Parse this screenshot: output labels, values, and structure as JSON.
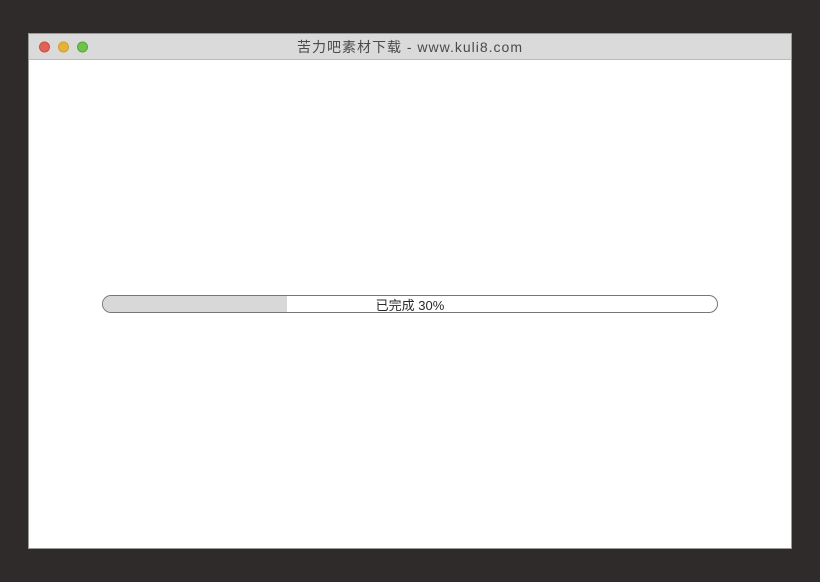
{
  "window": {
    "title": "苦力吧素材下载 - www.kuli8.com"
  },
  "progress": {
    "percent": 30,
    "label": "已完成 30%"
  }
}
